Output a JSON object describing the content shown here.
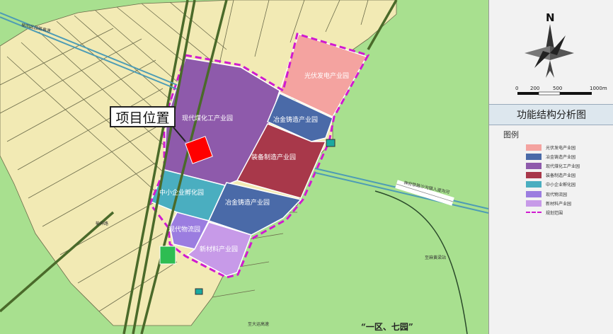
{
  "map": {
    "zones": [
      {
        "id": "pv",
        "label": "光伏发电产业园",
        "color": "#f4a3a0"
      },
      {
        "id": "metallurgy",
        "label": "冶金铸造产业园",
        "color": "#4a6aa8"
      },
      {
        "id": "coal",
        "label": "现代煤化工产业园",
        "color": "#8e5aab"
      },
      {
        "id": "equipment",
        "label": "装备制造产业园",
        "color": "#a8384a"
      },
      {
        "id": "sme",
        "label": "中小企业孵化园",
        "color": "#4aaec0"
      },
      {
        "id": "casting",
        "label": "冶金铸造产业园",
        "color": "#4a6aa8"
      },
      {
        "id": "logistics",
        "label": "现代物流园",
        "color": "#9b7de0"
      },
      {
        "id": "materials",
        "label": "新材料产业园",
        "color": "#c79ae8"
      }
    ],
    "project_callout": "项目位置",
    "road_labels": {
      "northwest": "榆阳区园路高速",
      "east": "神府铁路沙沟镇入渡沟河",
      "west": "榆神路",
      "south": "至大运高速",
      "station": "至麻黄梁站"
    },
    "slogan": "“一区、七园”",
    "colors": {
      "background_green": "#a8e08f",
      "block_yellow": "#f2eab4",
      "railway": "#4a6a2a",
      "boundary": "#d01ad0",
      "project_site": "#ff0000"
    }
  },
  "compass": {
    "north_label": "N",
    "scale_labels": [
      "0",
      "200",
      "500",
      "1000m"
    ]
  },
  "panel": {
    "title": "功能结构分析图"
  },
  "legend": {
    "title": "图例",
    "items": [
      {
        "label": "光伏发电产业园",
        "color": "#f4a3a0",
        "kind": "swatch"
      },
      {
        "label": "冶金铸造产业园",
        "color": "#4a6aa8",
        "kind": "swatch"
      },
      {
        "label": "现代煤化工产业园",
        "color": "#8e5aab",
        "kind": "swatch"
      },
      {
        "label": "装备制造产业园",
        "color": "#a8384a",
        "kind": "swatch"
      },
      {
        "label": "中小企业孵化园",
        "color": "#4aaec0",
        "kind": "swatch"
      },
      {
        "label": "现代物流园",
        "color": "#9b7de0",
        "kind": "swatch"
      },
      {
        "label": "新材料产业园",
        "color": "#c79ae8",
        "kind": "swatch"
      },
      {
        "label": "规划范围",
        "color": "#d01ad0",
        "kind": "dash"
      }
    ]
  }
}
